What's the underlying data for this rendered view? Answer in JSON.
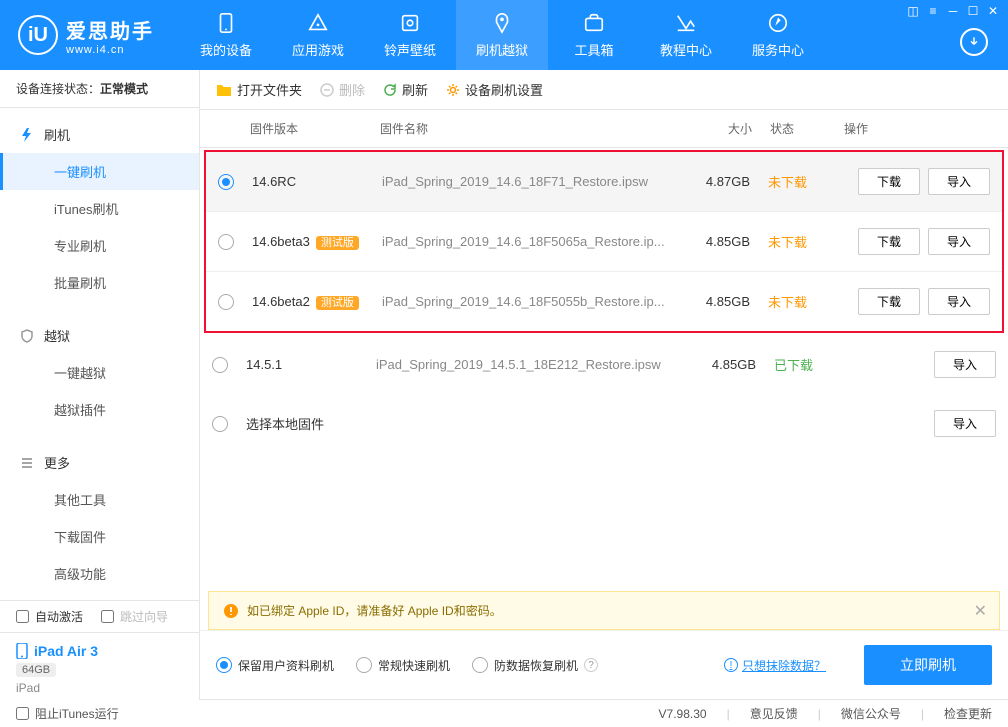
{
  "brand": {
    "cn": "爱思助手",
    "url": "www.i4.cn",
    "logo_letter": "iU"
  },
  "nav": {
    "items": [
      {
        "label": "我的设备"
      },
      {
        "label": "应用游戏"
      },
      {
        "label": "铃声壁纸"
      },
      {
        "label": "刷机越狱"
      },
      {
        "label": "工具箱"
      },
      {
        "label": "教程中心"
      },
      {
        "label": "服务中心"
      }
    ],
    "active_index": 3
  },
  "sidebar": {
    "conn_label": "设备连接状态：",
    "conn_value": "正常模式",
    "groups": [
      {
        "title": "刷机",
        "icon": "bolt",
        "items": [
          "一键刷机",
          "iTunes刷机",
          "专业刷机",
          "批量刷机"
        ],
        "active": 0
      },
      {
        "title": "越狱",
        "icon": "shield",
        "items": [
          "一键越狱",
          "越狱插件"
        ]
      },
      {
        "title": "更多",
        "icon": "menu",
        "items": [
          "其他工具",
          "下载固件",
          "高级功能"
        ]
      }
    ],
    "auto_activate": "自动激活",
    "skip_guide": "跳过向导",
    "device": {
      "name": "iPad Air 3",
      "capacity": "64GB",
      "type": "iPad"
    }
  },
  "toolbar": {
    "open": "打开文件夹",
    "delete": "删除",
    "refresh": "刷新",
    "settings": "设备刷机设置"
  },
  "table": {
    "head": {
      "version": "固件版本",
      "name": "固件名称",
      "size": "大小",
      "status": "状态",
      "ops": "操作"
    },
    "rows": [
      {
        "ver": "14.6RC",
        "beta": false,
        "name": "iPad_Spring_2019_14.6_18F71_Restore.ipsw",
        "size": "4.87GB",
        "status": "未下载",
        "downloaded": false,
        "selected": true
      },
      {
        "ver": "14.6beta3",
        "beta": true,
        "name": "iPad_Spring_2019_14.6_18F5065a_Restore.ip...",
        "size": "4.85GB",
        "status": "未下载",
        "downloaded": false,
        "selected": false
      },
      {
        "ver": "14.6beta2",
        "beta": true,
        "name": "iPad_Spring_2019_14.6_18F5055b_Restore.ip...",
        "size": "4.85GB",
        "status": "未下载",
        "downloaded": false,
        "selected": false
      }
    ],
    "rows_extra": [
      {
        "ver": "14.5.1",
        "beta": false,
        "name": "iPad_Spring_2019_14.5.1_18E212_Restore.ipsw",
        "size": "4.85GB",
        "status": "已下载",
        "downloaded": true,
        "selected": false
      }
    ],
    "local_firmware": "选择本地固件",
    "beta_tag": "测试版",
    "btn_download": "下载",
    "btn_import": "导入"
  },
  "notice": {
    "text": "如已绑定 Apple ID，请准备好 Apple ID和密码。"
  },
  "flash": {
    "opts": [
      "保留用户资料刷机",
      "常规快速刷机",
      "防数据恢复刷机"
    ],
    "opt_selected": 0,
    "erase_link": "只想抹除数据？",
    "flash_btn": "立即刷机"
  },
  "footer": {
    "block_itunes": "阻止iTunes运行",
    "version": "V7.98.30",
    "feedback": "意见反馈",
    "wechat": "微信公众号",
    "update": "检查更新"
  }
}
